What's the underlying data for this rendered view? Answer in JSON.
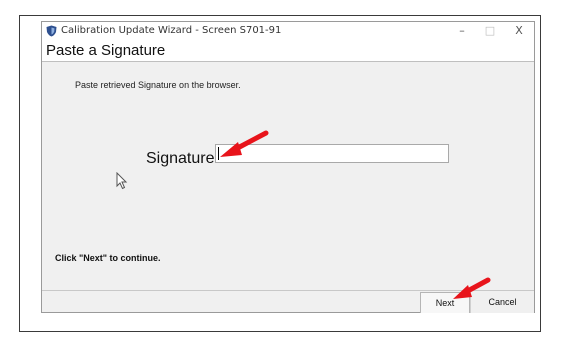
{
  "window": {
    "title": "Calibration Update Wizard - Screen S701-91",
    "minimize_glyph": "–",
    "maximize_glyph": "□",
    "close_glyph": "X"
  },
  "page": {
    "heading": "Paste a Signature",
    "instruction": "Paste retrieved Signature on the browser.",
    "signature_label": "Signature :",
    "signature_value": "",
    "continue_text": "Click \"Next\" to continue."
  },
  "buttons": {
    "next": "Next",
    "cancel": "Cancel"
  },
  "colors": {
    "annotation_arrow": "#e8141b",
    "app_icon": "#2e5090"
  }
}
